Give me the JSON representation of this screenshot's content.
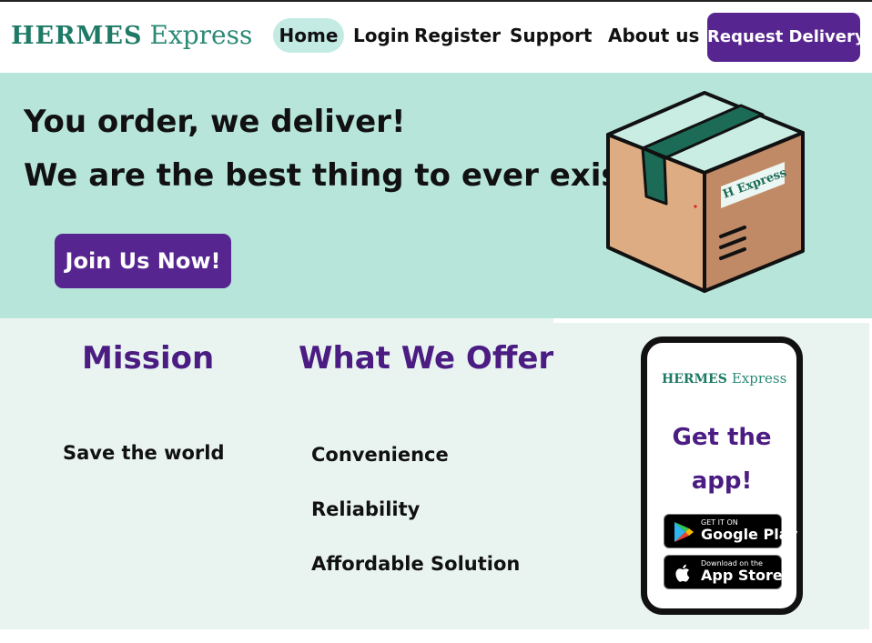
{
  "header": {
    "logo_primary": "HERMES",
    "logo_secondary": "Express",
    "nav": {
      "home": "Home",
      "login": "Login",
      "register": "Register",
      "support": "Support",
      "about": "About us"
    },
    "cta": "Request Delivery"
  },
  "hero": {
    "line1": "You order, we deliver!",
    "line2": "We are the best thing to ever exist.",
    "join_button": "Join Us Now!",
    "box_label": "H Express",
    "illustration_icon": "package-box-icon"
  },
  "mission": {
    "heading": "Mission",
    "text": "Save the world"
  },
  "offer": {
    "heading": "What We Offer",
    "items": [
      "Convenience",
      "Reliability",
      "Affordable Solution"
    ]
  },
  "app_card": {
    "logo_primary": "HERMES",
    "logo_secondary": "Express",
    "cta_line1": "Get the",
    "cta_line2": "app!",
    "google_play": {
      "small": "GET IT ON",
      "big": "Google Play",
      "icon": "google-play-icon"
    },
    "app_store": {
      "small": "Download on the",
      "big": "App Store",
      "icon": "apple-icon"
    }
  },
  "colors": {
    "brand_purple": "#57258f",
    "heading_purple": "#4b1c82",
    "teal_logo": "#1e7a66",
    "hero_bg": "#b7e5da",
    "section_bg": "#e9f4f1",
    "home_pill": "#c3ebe4"
  }
}
